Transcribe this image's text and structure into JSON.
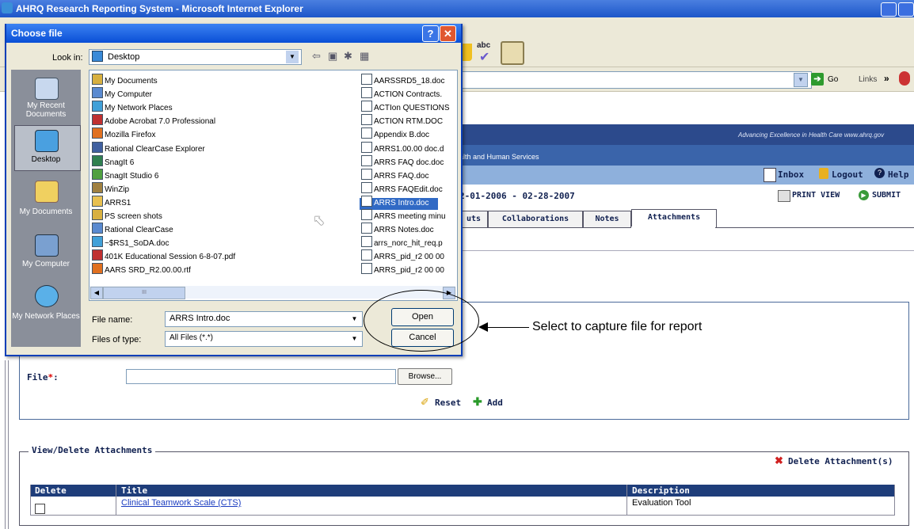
{
  "browser": {
    "title": "AHRQ Research Reporting System - Microsoft Internet Explorer",
    "go_label": "Go",
    "links_label": "Links",
    "links_chevron": "»"
  },
  "site": {
    "tagline": "Advancing Excellence in Health Care   www.ahrq.gov",
    "hhs_text": "alth and Human Services",
    "nav": {
      "inbox": "Inbox",
      "logout": "Logout",
      "help": "Help"
    },
    "period": "2-01-2006 - 02-28-2007",
    "print_view": "PRINT VIEW",
    "submit": "SUBMIT",
    "tabs": [
      {
        "label": "uts"
      },
      {
        "label": "Collaborations"
      },
      {
        "label": "Notes"
      },
      {
        "label": "Attachments"
      }
    ]
  },
  "upload": {
    "file_label": "File",
    "required_mark": "*",
    "file_colon": ":",
    "browse": "Browse...",
    "reset": "Reset",
    "add": "Add"
  },
  "attachments": {
    "legend": "View/Delete Attachments",
    "delete_button": "Delete Attachment(s)",
    "columns": [
      "Delete",
      "Title",
      "Description"
    ],
    "rows": [
      {
        "title": "Clinical Teamwork Scale (CTS)",
        "description": "Evaluation Tool"
      }
    ]
  },
  "annotation": {
    "text": "Select to capture file for report"
  },
  "dialog": {
    "title": "Choose file",
    "help_glyph": "?",
    "close_glyph": "✕",
    "look_in_label": "Look in:",
    "look_in_value": "Desktop",
    "places": [
      {
        "label": "My Recent Documents",
        "icon": "recent-documents-icon"
      },
      {
        "label": "Desktop",
        "icon": "desktop-icon"
      },
      {
        "label": "My Documents",
        "icon": "my-documents-icon"
      },
      {
        "label": "My Computer",
        "icon": "my-computer-icon"
      },
      {
        "label": "My Network Places",
        "icon": "network-places-icon"
      }
    ],
    "files_col1": [
      "My Documents",
      "My Computer",
      "My Network Places",
      "Adobe Acrobat 7.0 Professional",
      "Mozilla Firefox",
      "Rational ClearCase Explorer",
      "SnagIt 6",
      "SnagIt Studio 6",
      "WinZip",
      "ARRS1",
      "PS screen shots",
      "Rational ClearCase",
      "~$RS1_SoDA.doc",
      "401K Educational Session 6-8-07.pdf",
      "AARS SRD_R2.00.00.rtf"
    ],
    "files_col2": [
      "AARSSRD5_18.doc",
      "ACTION Contracts.",
      "ACTIon QUESTIONS",
      "ACTION RTM.DOC",
      "Appendix B.doc",
      "ARRS1.00.00 doc.d",
      "ARRS FAQ doc.doc",
      "ARRS FAQ.doc",
      "ARRS FAQEdit.doc",
      "ARRS Intro.doc",
      "ARRS meeting minu",
      "ARRS Notes.doc",
      "arrs_norc_hit_req.p",
      "ARRS_pid_r2 00 00",
      "ARRS_pid_r2 00 00"
    ],
    "selected_file": "ARRS Intro.doc",
    "file_name_label": "File name:",
    "file_name_value": "ARRS Intro.doc",
    "files_of_type_label": "Files of type:",
    "files_of_type_value": "All Files (*.*)",
    "open": "Open",
    "cancel": "Cancel",
    "scroll_glyph": "III"
  }
}
